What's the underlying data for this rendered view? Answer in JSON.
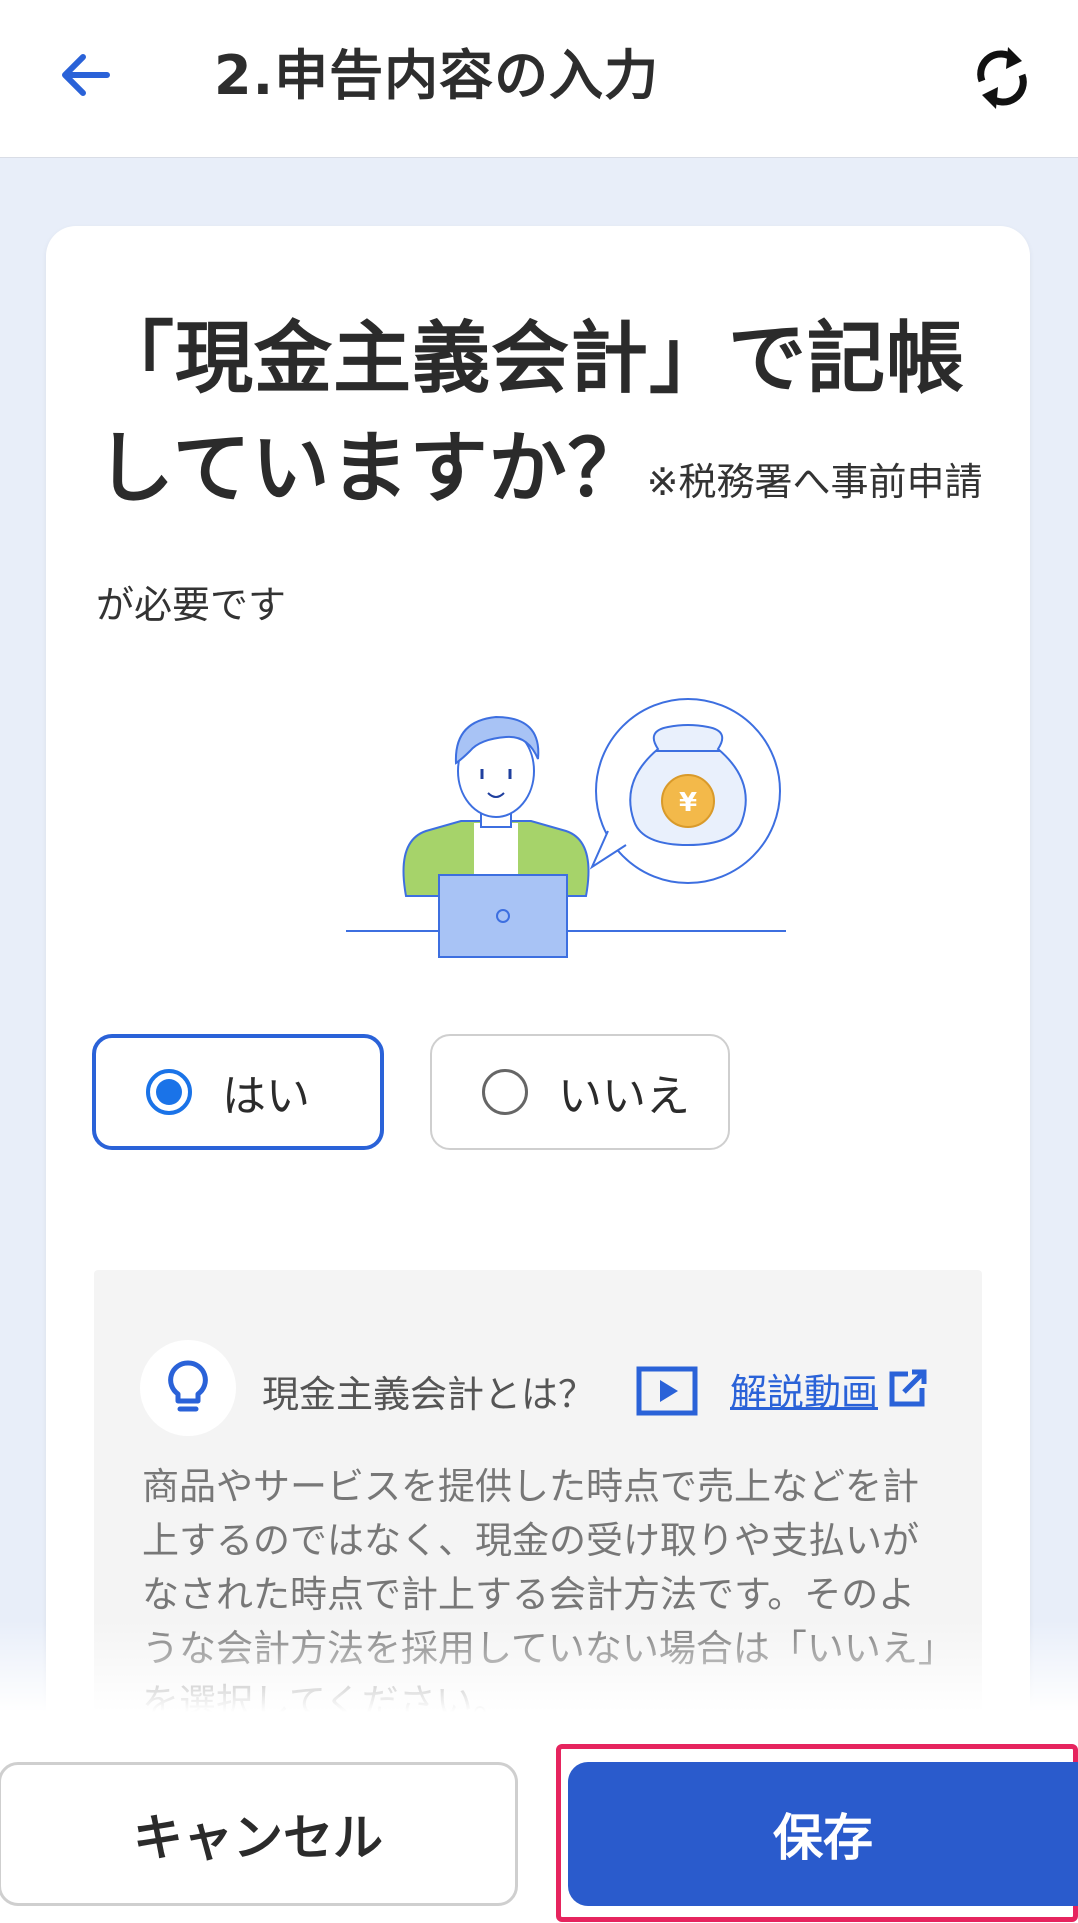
{
  "header": {
    "title": "2.申告内容の入力"
  },
  "question": {
    "main": "「現金主義会計」で記帳していますか？",
    "note": "※税務署へ事前申請が必要です"
  },
  "options": {
    "yes": {
      "label": "はい",
      "selected": true
    },
    "no": {
      "label": "いいえ",
      "selected": false
    }
  },
  "info": {
    "title": "現金主義会計とは？",
    "video_link": "解説動画",
    "body": "商品やサービスを提供した時点で売上などを計上するのではなく、現金の受け取りや支払いがなされた時点で計上する会計方法です。そのような会計方法を採用していない場合は「いいえ」を選択してください。"
  },
  "actions": {
    "cancel_label": "キャンセル",
    "save_label": "保存"
  },
  "colors": {
    "accent": "#2a62d8",
    "save_button": "#2a5bcc",
    "highlight_border": "#e6245e",
    "page_background": "#e8eef9"
  },
  "icons": {
    "back": "arrow-left-icon",
    "refresh": "refresh-icon",
    "bulb": "lightbulb-icon",
    "play": "play-video-icon",
    "external": "external-link-icon"
  }
}
